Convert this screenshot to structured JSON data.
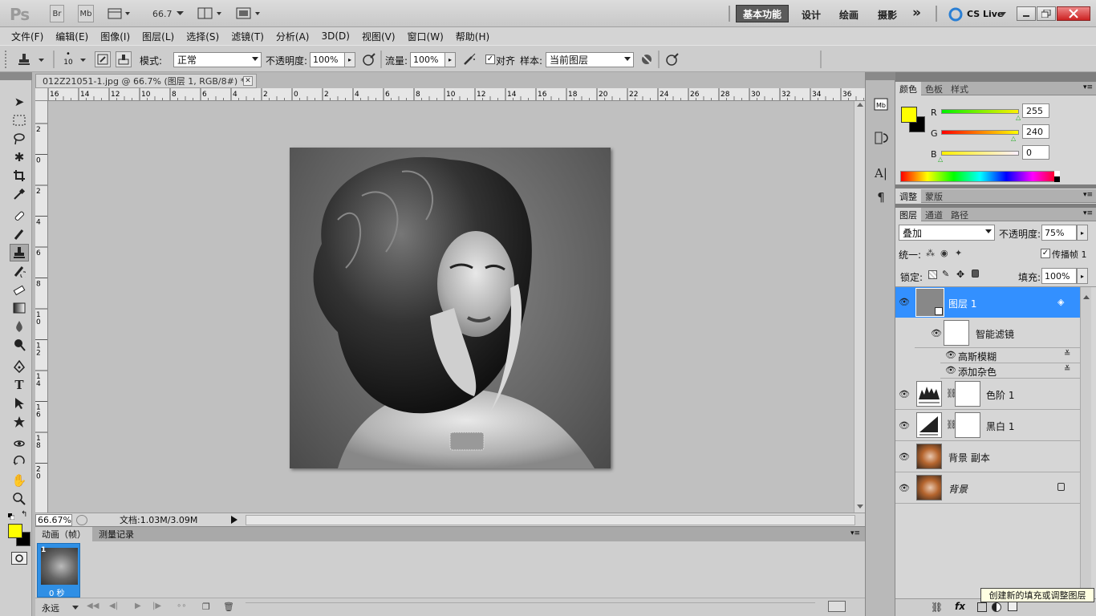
{
  "app": {
    "logo": "Ps",
    "bridge_label": "Br",
    "minibridge_label": "Mb",
    "zoom_combo": "66.7",
    "workspaces": [
      "基本功能",
      "设计",
      "绘画",
      "摄影"
    ],
    "more_label": "»",
    "cslive": "CS Live"
  },
  "menu": [
    "文件(F)",
    "编辑(E)",
    "图像(I)",
    "图层(L)",
    "选择(S)",
    "滤镜(T)",
    "分析(A)",
    "3D(D)",
    "视图(V)",
    "窗口(W)",
    "帮助(H)"
  ],
  "options": {
    "brush_size": "10",
    "mode_label": "模式:",
    "mode_value": "正常",
    "opacity_label": "不透明度:",
    "opacity_value": "100%",
    "flow_label": "流量:",
    "flow_value": "100%",
    "align_label": "对齐",
    "sample_label": "样本:",
    "sample_value": "当前图层"
  },
  "document": {
    "tab_title": "012Z21051-1.jpg @ 66.7% (图层 1, RGB/8#) *",
    "ruler_h": [
      "16",
      "14",
      "12",
      "10",
      "8",
      "6",
      "4",
      "2",
      "0",
      "2",
      "4",
      "6",
      "8",
      "10",
      "12",
      "14",
      "16",
      "18",
      "20",
      "22",
      "24",
      "26",
      "28",
      "30",
      "32",
      "34",
      "36"
    ],
    "ruler_v": [
      "2",
      "0",
      "2",
      "4",
      "6",
      "8",
      "1\n0",
      "1\n2",
      "1\n4",
      "1\n6",
      "1\n8",
      "2\n0"
    ],
    "zoom": "66.67%",
    "file_info": "文档:1.03M/3.09M"
  },
  "animation": {
    "tabs": [
      "动画（帧）",
      "测量记录"
    ],
    "frame_number": "1",
    "frame_delay": "0 秒",
    "loop": "永远"
  },
  "color_panel": {
    "tabs": [
      "颜色",
      "色板",
      "样式"
    ],
    "r_label": "R",
    "r_value": "255",
    "r_fraction": 1.0,
    "g_label": "G",
    "g_value": "240",
    "g_fraction": 0.941,
    "b_label": "B",
    "b_value": "0",
    "b_fraction": 0.0,
    "fg_color": "#ffff00",
    "bg_color": "#000000"
  },
  "adjust_panel": {
    "tabs": [
      "调整",
      "蒙版"
    ]
  },
  "layers_panel": {
    "tabs": [
      "图层",
      "通道",
      "路径"
    ],
    "blend_mode": "叠加",
    "opacity_label": "不透明度:",
    "opacity_value": "75%",
    "unify_label": "统一:",
    "propagate_label": "传播帧 1",
    "lock_label": "锁定:",
    "fill_label": "填充:",
    "fill_value": "100%",
    "layers": [
      {
        "name": "图层 1",
        "selected": true
      },
      {
        "name": "智能滤镜"
      },
      {
        "name": "高斯模糊"
      },
      {
        "name": "添加杂色"
      },
      {
        "name": "色阶 1"
      },
      {
        "name": "黑白 1"
      },
      {
        "name": "背景 副本"
      },
      {
        "name": "背景"
      }
    ]
  },
  "tooltip": "创建新的填充或调整图层"
}
